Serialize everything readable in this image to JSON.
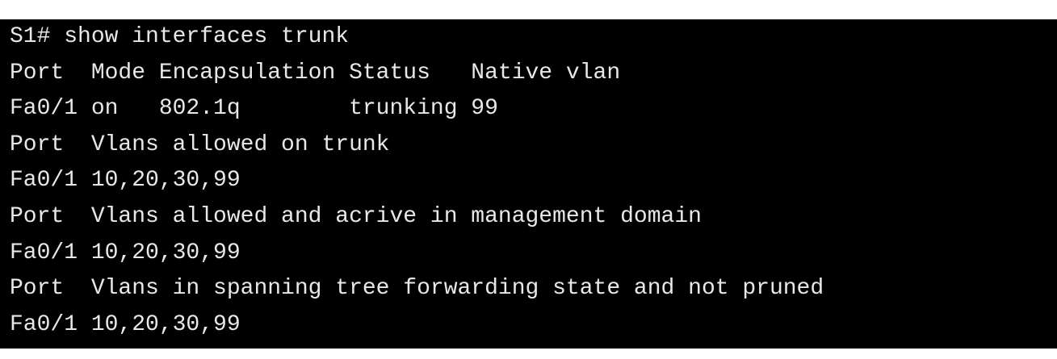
{
  "terminal": {
    "lines": [
      "S1# show interfaces trunk",
      "Port  Mode Encapsulation Status   Native vlan",
      "Fa0/1 on   802.1q        trunking 99",
      "Port  Vlans allowed on trunk",
      "Fa0/1 10,20,30,99",
      "Port  Vlans allowed and acrive in management domain",
      "Fa0/1 10,20,30,99",
      "Port  Vlans in spanning tree forwarding state and not pruned",
      "Fa0/1 10,20,30,99"
    ]
  },
  "colors": {
    "background": "#000000",
    "text": "#e8e8e8",
    "page": "#ffffff"
  }
}
